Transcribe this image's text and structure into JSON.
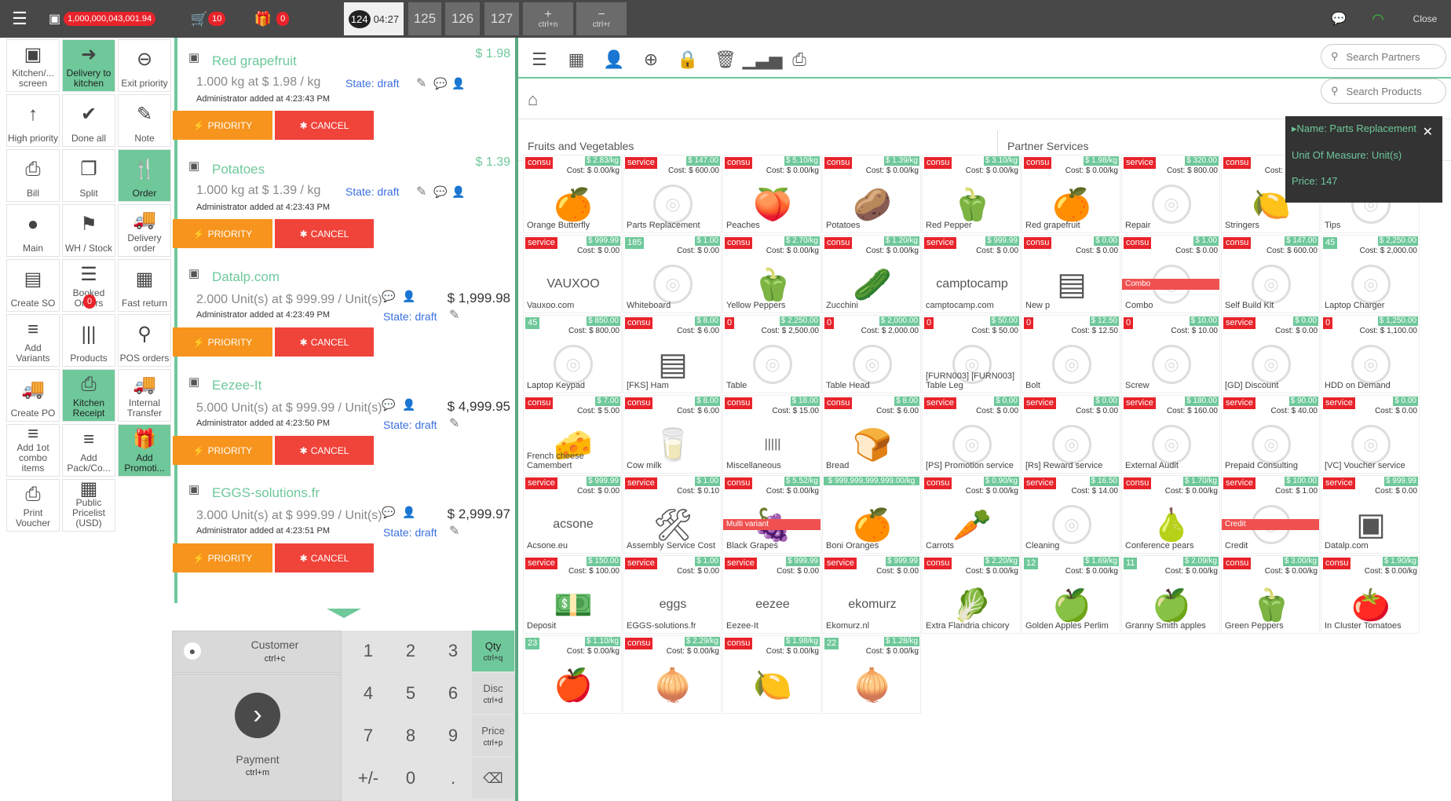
{
  "topbar": {
    "balance": "1,000,000,043,001.94",
    "cart_count": "10",
    "gift_count": "0",
    "close": "Close",
    "tabs": [
      {
        "num": "124",
        "time": "04:27"
      },
      {
        "num": "125"
      },
      {
        "num": "126"
      },
      {
        "num": "127"
      }
    ],
    "shortcut_add": "ctrl+n",
    "shortcut_remove": "ctrl+r"
  },
  "controls": [
    {
      "label": "Kitchen/... screen",
      "icon": "▣"
    },
    {
      "label": "Delivery to kitchen",
      "icon": "➜",
      "green": true
    },
    {
      "label": "Exit priority",
      "icon": "⊖"
    },
    {
      "label": "High priority",
      "icon": "↑"
    },
    {
      "label": "Done all",
      "icon": "✔"
    },
    {
      "label": "Note",
      "icon": "✎"
    },
    {
      "label": "Bill",
      "icon": "⎙"
    },
    {
      "label": "Split",
      "icon": "❐"
    },
    {
      "label": "Order",
      "icon": "🍴",
      "green": true
    },
    {
      "label": "Main",
      "icon": "●"
    },
    {
      "label": "WH / Stock",
      "icon": "⚑"
    },
    {
      "label": "Delivery order",
      "icon": "🚚"
    },
    {
      "label": "Create SO",
      "icon": "▤"
    },
    {
      "label": "Booked Orders",
      "icon": "☰",
      "badge": "0"
    },
    {
      "label": "Fast return",
      "icon": "▦"
    },
    {
      "label": "Add Variants",
      "icon": "≡"
    },
    {
      "label": "Products",
      "icon": "|||"
    },
    {
      "label": "POS orders",
      "icon": "⚲"
    },
    {
      "label": "Create PO",
      "icon": "🚚"
    },
    {
      "label": "Kitchen Receipt",
      "icon": "⎙",
      "green": true
    },
    {
      "label": "Internal Transfer",
      "icon": "🚚"
    },
    {
      "label": "Add 1ot combo items",
      "icon": "≡"
    },
    {
      "label": "Add Pack/Co...",
      "icon": "≡"
    },
    {
      "label": "Add Promoti...",
      "icon": "🎁",
      "green": true
    },
    {
      "label": "Print Voucher",
      "icon": "⎙"
    },
    {
      "label": "Public Pricelist (USD)",
      "icon": "▦"
    }
  ],
  "orderlines": [
    {
      "name": "Red grapefruit",
      "price": "$ 1.98",
      "detail": "1.000 kg at $ 1.98 / kg",
      "added": "Administrator added at 4:23:43 PM",
      "state": "State: draft",
      "total": ""
    },
    {
      "name": "Potatoes",
      "price": "$ 1.39",
      "detail": "1.000 kg at $ 1.39 / kg",
      "added": "Administrator added at 4:23:43 PM",
      "state": "State: draft",
      "total": ""
    },
    {
      "name": "Datalp.com",
      "price": "",
      "detail": "2.000 Unit(s) at $ 999.99 / Unit(s)",
      "added": "Administrator added at 4:23:49 PM",
      "state": "State: draft",
      "total": "$ 1,999.98"
    },
    {
      "name": "Eezee-It",
      "price": "",
      "detail": "5.000 Unit(s) at $ 999.99 / Unit(s)",
      "added": "Administrator added at 4:23:50 PM",
      "state": "State: draft",
      "total": "$ 4,999.95"
    },
    {
      "name": "EGGS-solutions.fr",
      "price": "",
      "detail": "3.000 Unit(s) at $ 999.99 / Unit(s)",
      "added": "Administrator added at 4:23:51 PM",
      "state": "State: draft",
      "total": "$ 2,999.97"
    }
  ],
  "order_buttons": {
    "priority": "PRIORITY",
    "cancel": "CANCEL"
  },
  "keypad": {
    "customer": "Customer",
    "customer_sc": "ctrl+c",
    "payment": "Payment",
    "payment_sc": "ctrl+m",
    "keys": [
      "1",
      "2",
      "3",
      "4",
      "5",
      "6",
      "7",
      "8",
      "9",
      "+/-",
      "0",
      "."
    ],
    "side": [
      {
        "label": "Qty",
        "sc": "ctrl+q"
      },
      {
        "label": "Disc",
        "sc": "ctrl+d"
      },
      {
        "label": "Price",
        "sc": "ctrl+p"
      }
    ]
  },
  "search_partners": "Search Partners",
  "search_products": "Search Products",
  "categories": [
    "Fruits and Vegetables",
    "Partner Services"
  ],
  "tooltip": [
    "Name: Parts Replacement",
    "Unit Of Measure: Unit(s)",
    "Price: 147"
  ],
  "products": [
    {
      "n": "Orange Butterfly",
      "t": "consu",
      "p": "$ 2.83/kg",
      "c": "Cost: $ 0.00/kg",
      "e": "🍊"
    },
    {
      "n": "Parts Replacement",
      "t": "service",
      "p": "$ 147.00",
      "c": "Cost: $ 600.00"
    },
    {
      "n": "Peaches",
      "t": "consu",
      "p": "$ 5.10/kg",
      "c": "Cost: $ 0.00/kg",
      "e": "🍑"
    },
    {
      "n": "Potatoes",
      "t": "consu",
      "p": "$ 1.39/kg",
      "c": "Cost: $ 0.00/kg",
      "e": "🥔"
    },
    {
      "n": "Red Pepper",
      "t": "consu",
      "p": "$ 3.10/kg",
      "c": "Cost: $ 0.00/kg",
      "e": "🫑"
    },
    {
      "n": "Red grapefruit",
      "t": "consu",
      "p": "$ 1.98/kg",
      "c": "Cost: $ 0.00/kg",
      "e": "🍊"
    },
    {
      "n": "Repair",
      "t": "service",
      "p": "$ 320.00",
      "c": "Cost: $ 800.00"
    },
    {
      "n": "Stringers",
      "t": "consu",
      "p": "",
      "c": "Cost: $ 0.00/kg",
      "e": "🍋"
    },
    {
      "n": "Tips",
      "t": "",
      "p": "",
      "c": "Cost: $ 0.00"
    },
    {
      "n": "Vauxoo.com",
      "t": "service",
      "p": "$ 999.99",
      "c": "Cost: $ 0.00",
      "e": "VAUXOO"
    },
    {
      "n": "Whiteboard",
      "t": "185",
      "p": "$ 1.00",
      "c": "Cost: $ 0.00"
    },
    {
      "n": "Yellow Peppers",
      "t": "consu",
      "p": "$ 2.70/kg",
      "c": "Cost: $ 0.00/kg",
      "e": "🫑"
    },
    {
      "n": "Zucchini",
      "t": "consu",
      "p": "$ 1.20/kg",
      "c": "Cost: $ 0.00/kg",
      "e": "🥒"
    },
    {
      "n": "camptocamp.com",
      "t": "service",
      "p": "$ 999.99",
      "c": "Cost: $ 0.00",
      "e": "camptocamp"
    },
    {
      "n": "New p",
      "t": "consu",
      "p": "$ 0.00",
      "c": "Cost: $ 0.00",
      "e": "▤"
    },
    {
      "n": "Combo",
      "t": "consu",
      "p": "$ 1.00",
      "c": "Cost: $ 0.00",
      "ribbon": "Combo"
    },
    {
      "n": "Self Build Kit",
      "t": "consu",
      "p": "$ 147.00",
      "c": "Cost: $ 600.00"
    },
    {
      "n": "Laptop Charger",
      "t": "45",
      "p": "$ 2,250.00",
      "c": "Cost: $ 2,000.00"
    },
    {
      "n": "Laptop Keypad",
      "t": "45",
      "p": "$ 850.00",
      "c": "Cost: $ 800.00"
    },
    {
      "n": "[FKS] Ham",
      "t": "consu",
      "p": "$ 8.00",
      "c": "Cost: $ 6.00",
      "e": "▤"
    },
    {
      "n": "Table",
      "t": "0",
      "p": "$ 2,250.00",
      "c": "Cost: $ 2,500.00"
    },
    {
      "n": "Table Head",
      "t": "0",
      "p": "$ 2,000.00",
      "c": "Cost: $ 2,000.00"
    },
    {
      "n": "[FURN003] [FURN003] Table Leg",
      "t": "0",
      "p": "$ 50.00",
      "c": "Cost: $ 50.00"
    },
    {
      "n": "Bolt",
      "t": "0",
      "p": "$ 12.50",
      "c": "Cost: $ 12.50"
    },
    {
      "n": "Screw",
      "t": "0",
      "p": "$ 10.00",
      "c": "Cost: $ 10.00"
    },
    {
      "n": "[GD] Discount",
      "t": "service",
      "p": "$ 0.00",
      "c": "Cost: $ 0.00"
    },
    {
      "n": "HDD on Demand",
      "t": "0",
      "p": "$ 1,250.00",
      "c": "Cost: $ 1,100.00"
    },
    {
      "n": "French cheese Camembert",
      "t": "consu",
      "p": "$ 7.00",
      "c": "Cost: $ 5.00",
      "e": "🧀"
    },
    {
      "n": "Cow milk",
      "t": "consu",
      "p": "$ 8.00",
      "c": "Cost: $ 6.00",
      "e": "🥛"
    },
    {
      "n": "Miscellaneous",
      "t": "consu",
      "p": "$ 18.00",
      "c": "Cost: $ 15.00",
      "e": "|||||"
    },
    {
      "n": "Bread",
      "t": "consu",
      "p": "$ 8.00",
      "c": "Cost: $ 6.00",
      "e": "🍞"
    },
    {
      "n": "[PS] Promotion service",
      "t": "service",
      "p": "$ 0.00",
      "c": "Cost: $ 0.00"
    },
    {
      "n": "[Rs] Reward service",
      "t": "service",
      "p": "$ 0.00",
      "c": "Cost: $ 0.00"
    },
    {
      "n": "External Audit",
      "t": "service",
      "p": "$ 180.00",
      "c": "Cost: $ 160.00"
    },
    {
      "n": "Prepaid Consulting",
      "t": "service",
      "p": "$ 90.00",
      "c": "Cost: $ 40.00"
    },
    {
      "n": "[VC] Voucher service",
      "t": "service",
      "p": "$ 0.00",
      "c": "Cost: $ 0.00"
    },
    {
      "n": "Acsone.eu",
      "t": "service",
      "p": "$ 999.99",
      "c": "Cost: $ 0.00",
      "e": "acsone"
    },
    {
      "n": "Assembly Service Cost",
      "t": "service",
      "p": "$ 1.00",
      "c": "Cost: $ 0.10",
      "e": "🛠"
    },
    {
      "n": "Black Grapes",
      "t": "consu",
      "p": "$ 5.52/kg",
      "c": "Cost: $ 0.00/kg",
      "e": "🍇",
      "ribbon": "Multi variant"
    },
    {
      "n": "Boni Oranges",
      "t": "",
      "p": "$ 999,999,999,999.00/kg",
      "c": "",
      "e": "🍊",
      "wide": true
    },
    {
      "n": "Carrots",
      "t": "consu",
      "p": "$ 0.90/kg",
      "c": "Cost: $ 0.00/kg",
      "e": "🥕"
    },
    {
      "n": "Cleaning",
      "t": "service",
      "p": "$ 16.50",
      "c": "Cost: $ 14.00"
    },
    {
      "n": "Conference pears",
      "t": "consu",
      "p": "$ 1.70/kg",
      "c": "Cost: $ 0.00/kg",
      "e": "🍐"
    },
    {
      "n": "Credit",
      "t": "service",
      "p": "$ 100.00",
      "c": "Cost: $ 1.00",
      "ribbon": "Credit"
    },
    {
      "n": "Datalp.com",
      "t": "service",
      "p": "$ 999.99",
      "c": "Cost: $ 0.00",
      "e": "▣"
    },
    {
      "n": "Deposit",
      "t": "service",
      "p": "$ 150.00",
      "c": "Cost: $ 100.00",
      "e": "💵"
    },
    {
      "n": "EGGS-solutions.fr",
      "t": "service",
      "p": "$ 1.00",
      "c": "Cost: $ 0.00",
      "e": "eggs"
    },
    {
      "n": "Eezee-It",
      "t": "service",
      "p": "$ 999.99",
      "c": "Cost: $ 0.00",
      "e": "eezee"
    },
    {
      "n": "Ekomurz.nl",
      "t": "service",
      "p": "$ 999.99",
      "c": "Cost: $ 0.00",
      "e": "ekomurz"
    },
    {
      "n": "Extra Flandria chicory",
      "t": "consu",
      "p": "$ 2.20/kg",
      "c": "Cost: $ 0.00/kg",
      "e": "🥬"
    },
    {
      "n": "Golden Apples Perlim",
      "t": "12",
      "p": "$ 1.69/kg",
      "c": "Cost: $ 0.00/kg",
      "e": "🍏"
    },
    {
      "n": "Granny Smith apples",
      "t": "11",
      "p": "$ 2.09/kg",
      "c": "Cost: $ 0.00/kg",
      "e": "🍏"
    },
    {
      "n": "Green Peppers",
      "t": "consu",
      "p": "$ 3.00/kg",
      "c": "Cost: $ 0.00/kg",
      "e": "🫑"
    },
    {
      "n": "In Cluster Tomatoes",
      "t": "consu",
      "p": "$ 1.90/kg",
      "c": "Cost: $ 0.00/kg",
      "e": "🍅"
    },
    {
      "n": "",
      "t": "23",
      "p": "$ 1.10/kg",
      "c": "Cost: $ 0.00/kg",
      "e": "🍎"
    },
    {
      "n": "",
      "t": "consu",
      "p": "$ 2.29/kg",
      "c": "Cost: $ 0.00/kg",
      "e": "🧅"
    },
    {
      "n": "",
      "t": "consu",
      "p": "$ 1.98/kg",
      "c": "Cost: $ 0.00/kg",
      "e": "🍋"
    },
    {
      "n": "",
      "t": "22",
      "p": "$ 1.28/kg",
      "c": "Cost: $ 0.00/kg",
      "e": "🧅"
    }
  ],
  "colors": {
    "green": "#6ec89a",
    "red": "#e8232a",
    "orange": "#f7941d",
    "cancel": "#f0433a"
  }
}
